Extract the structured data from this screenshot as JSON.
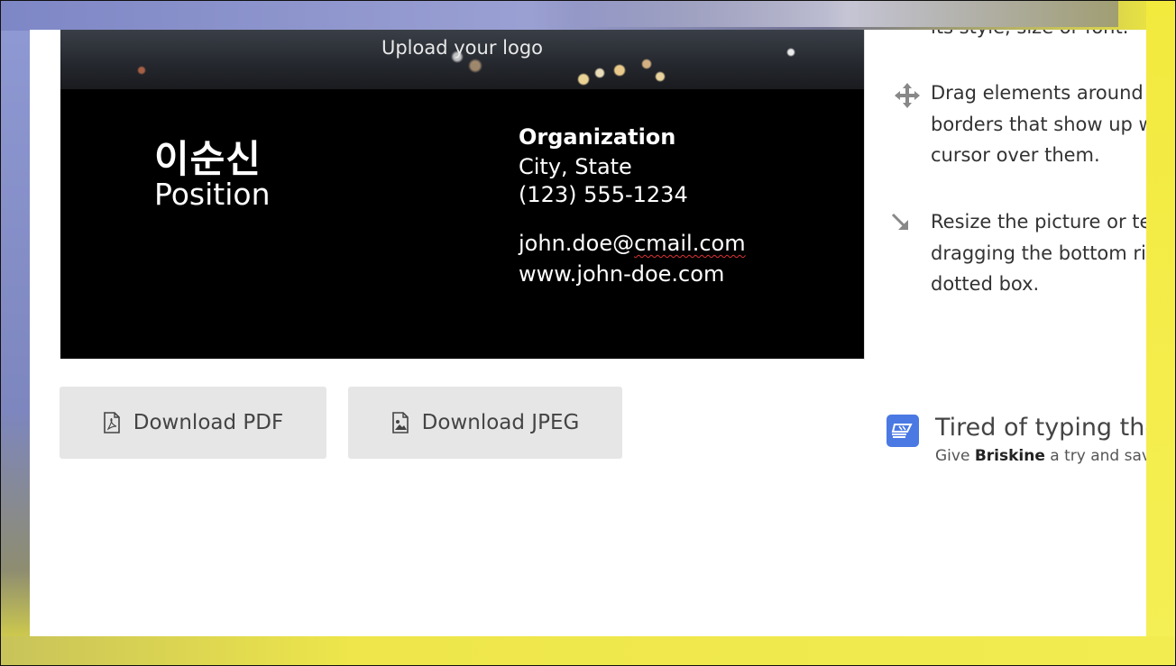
{
  "card": {
    "upload_logo": "Upload your logo",
    "name": "이순신",
    "position": "Position",
    "organization": "Organization",
    "city_state": "City, State",
    "phone": "(123) 555-1234",
    "email": "john.doe@cmail.com",
    "email_prefix": "john.doe@",
    "email_misspelled": "cmail.com",
    "website": "www.john-doe.com"
  },
  "buttons": {
    "download_pdf": "Download PDF",
    "download_jpeg": "Download JPEG"
  },
  "instructions": {
    "style_line": "its style, size or font.",
    "drag_line1": "Drag elements around u",
    "drag_line2": "borders that show up w",
    "drag_line3": "cursor over them.",
    "resize_line1": "Resize the picture or tex",
    "resize_line2": "dragging the bottom rig",
    "resize_line3": "dotted box."
  },
  "promo": {
    "title": "Tired of typing the",
    "sub_prefix": "Give ",
    "sub_brand": "Briskine",
    "sub_suffix": " a try and save"
  },
  "icons": {
    "move": "move-icon",
    "resize": "resize-arrow-icon",
    "pdf": "pdf-file-icon",
    "jpeg": "image-file-icon",
    "briskine": "briskine-logo-icon"
  },
  "colors": {
    "card_bg": "#000000",
    "button_bg": "#e6e6e6",
    "briskine_blue": "#4a79e3"
  }
}
